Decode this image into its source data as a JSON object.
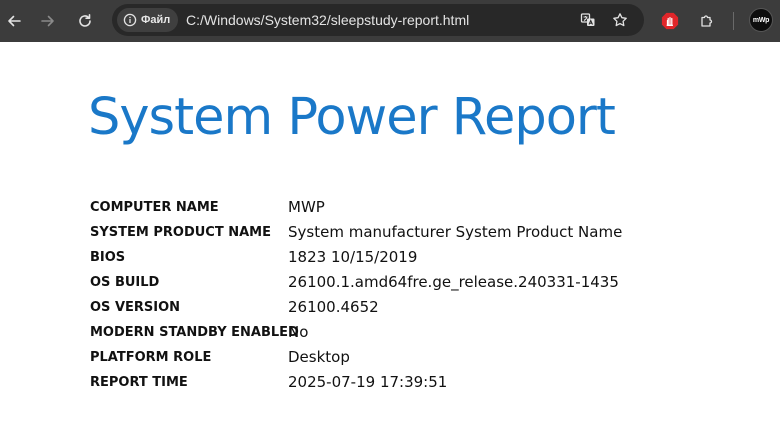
{
  "browser": {
    "site_info_label": "Файл",
    "url": "C:/Windows/System32/sleepstudy-report.html",
    "profile_initials": "mWp"
  },
  "report": {
    "title": "System Power Report",
    "rows": [
      {
        "label": "COMPUTER NAME",
        "value": "MWP"
      },
      {
        "label": "SYSTEM PRODUCT NAME",
        "value": "System manufacturer System Product Name"
      },
      {
        "label": "BIOS",
        "value": "1823 10/15/2019"
      },
      {
        "label": "OS BUILD",
        "value": "26100.1.amd64fre.ge_release.240331-1435"
      },
      {
        "label": "OS VERSION",
        "value": "26100.4652"
      },
      {
        "label": "MODERN STANDBY ENABLED",
        "value": "No"
      },
      {
        "label": "PLATFORM ROLE",
        "value": "Desktop"
      },
      {
        "label": "REPORT TIME",
        "value": "2025-07-19 17:39:51"
      }
    ]
  },
  "colors": {
    "title": "#1a78c8",
    "toolbar": "#3c3c3c",
    "omnibox": "#282828"
  }
}
